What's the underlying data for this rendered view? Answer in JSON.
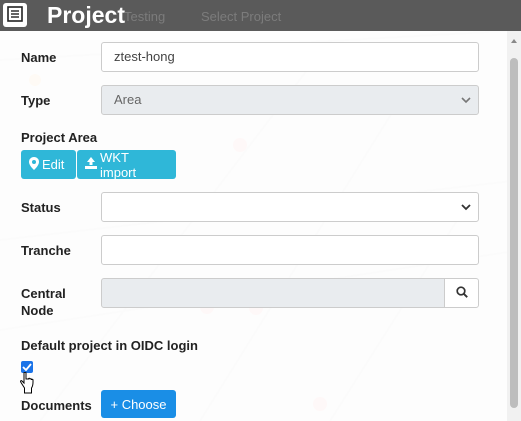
{
  "header": {
    "title": "Project",
    "ghost_tab_1": "Testing",
    "ghost_tab_2": "Select Project"
  },
  "form": {
    "name_label": "Name",
    "name_value": "ztest-hong",
    "type_label": "Type",
    "type_value": "Area",
    "project_area_label": "Project Area",
    "edit_button": "Edit",
    "wkt_import_button": "WKT import",
    "status_label": "Status",
    "status_value": "",
    "tranche_label": "Tranche",
    "tranche_value": "",
    "central_node_label_line1": "Central",
    "central_node_label_line2": "Node",
    "central_node_value": "",
    "default_project_label": "Default project in OIDC login",
    "default_project_checked": true,
    "documents_label": "Documents",
    "choose_button": "+ Choose"
  },
  "icons": {
    "menu": "list-menu-icon",
    "edit": "map-marker-icon",
    "wkt": "upload-icon",
    "search": "search-icon",
    "select": "chevron-down-icon"
  },
  "colors": {
    "header": "#5a5a5a",
    "info_button": "#2fb7d8",
    "primary_button": "#1a8ee6",
    "checkbox": "#1a73e8"
  }
}
